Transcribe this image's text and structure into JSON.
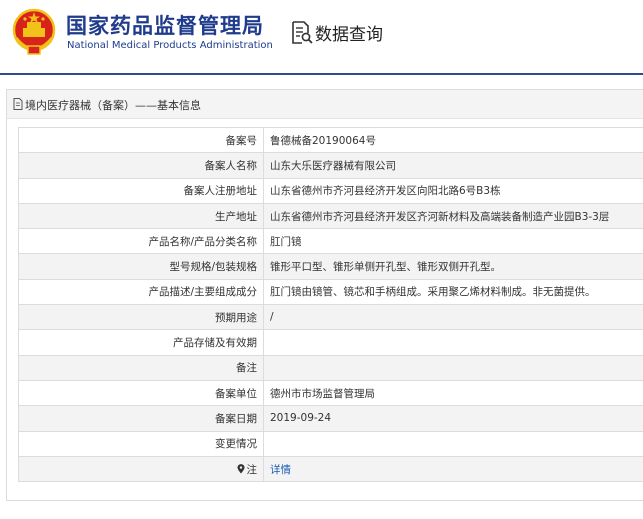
{
  "header": {
    "org_name_cn": "国家药品监督管理局",
    "org_name_en": "National Medical Products Administration",
    "query_title": "数据查询"
  },
  "panel": {
    "breadcrumb": "境内医疗器械（备案）——基本信息"
  },
  "rows": [
    {
      "label": "备案号",
      "value": "鲁德械备20190064号"
    },
    {
      "label": "备案人名称",
      "value": "山东大乐医疗器械有限公司"
    },
    {
      "label": "备案人注册地址",
      "value": "山东省德州市齐河县经济开发区向阳北路6号B3栋"
    },
    {
      "label": "生产地址",
      "value": "山东省德州市齐河县经济开发区齐河新材料及高端装备制造产业园B3-3层"
    },
    {
      "label": "产品名称/产品分类名称",
      "value": "肛门镜"
    },
    {
      "label": "型号规格/包装规格",
      "value": "锥形平口型、锥形单侧开孔型、锥形双侧开孔型。"
    },
    {
      "label": "产品描述/主要组成成分",
      "value": "肛门镜由镜管、镜芯和手柄组成。采用聚乙烯材料制成。非无菌提供。"
    },
    {
      "label": "预期用途",
      "value": "/"
    },
    {
      "label": "产品存储及有效期",
      "value": ""
    },
    {
      "label": "备注",
      "value": ""
    },
    {
      "label": "备案单位",
      "value": "德州市市场监督管理局"
    },
    {
      "label": "备案日期",
      "value": "2019-09-24"
    },
    {
      "label": "变更情况",
      "value": ""
    },
    {
      "label": "注",
      "value": "详情"
    }
  ],
  "colors": {
    "brand": "#1f3b8c",
    "link": "#1a5fb4",
    "emblem_red": "#d8231a",
    "emblem_gold": "#f2c11a"
  },
  "icons": {
    "emblem": "national-emblem-icon",
    "query": "document-search-icon",
    "breadcrumb": "document-icon",
    "note": "map-pin-icon"
  }
}
